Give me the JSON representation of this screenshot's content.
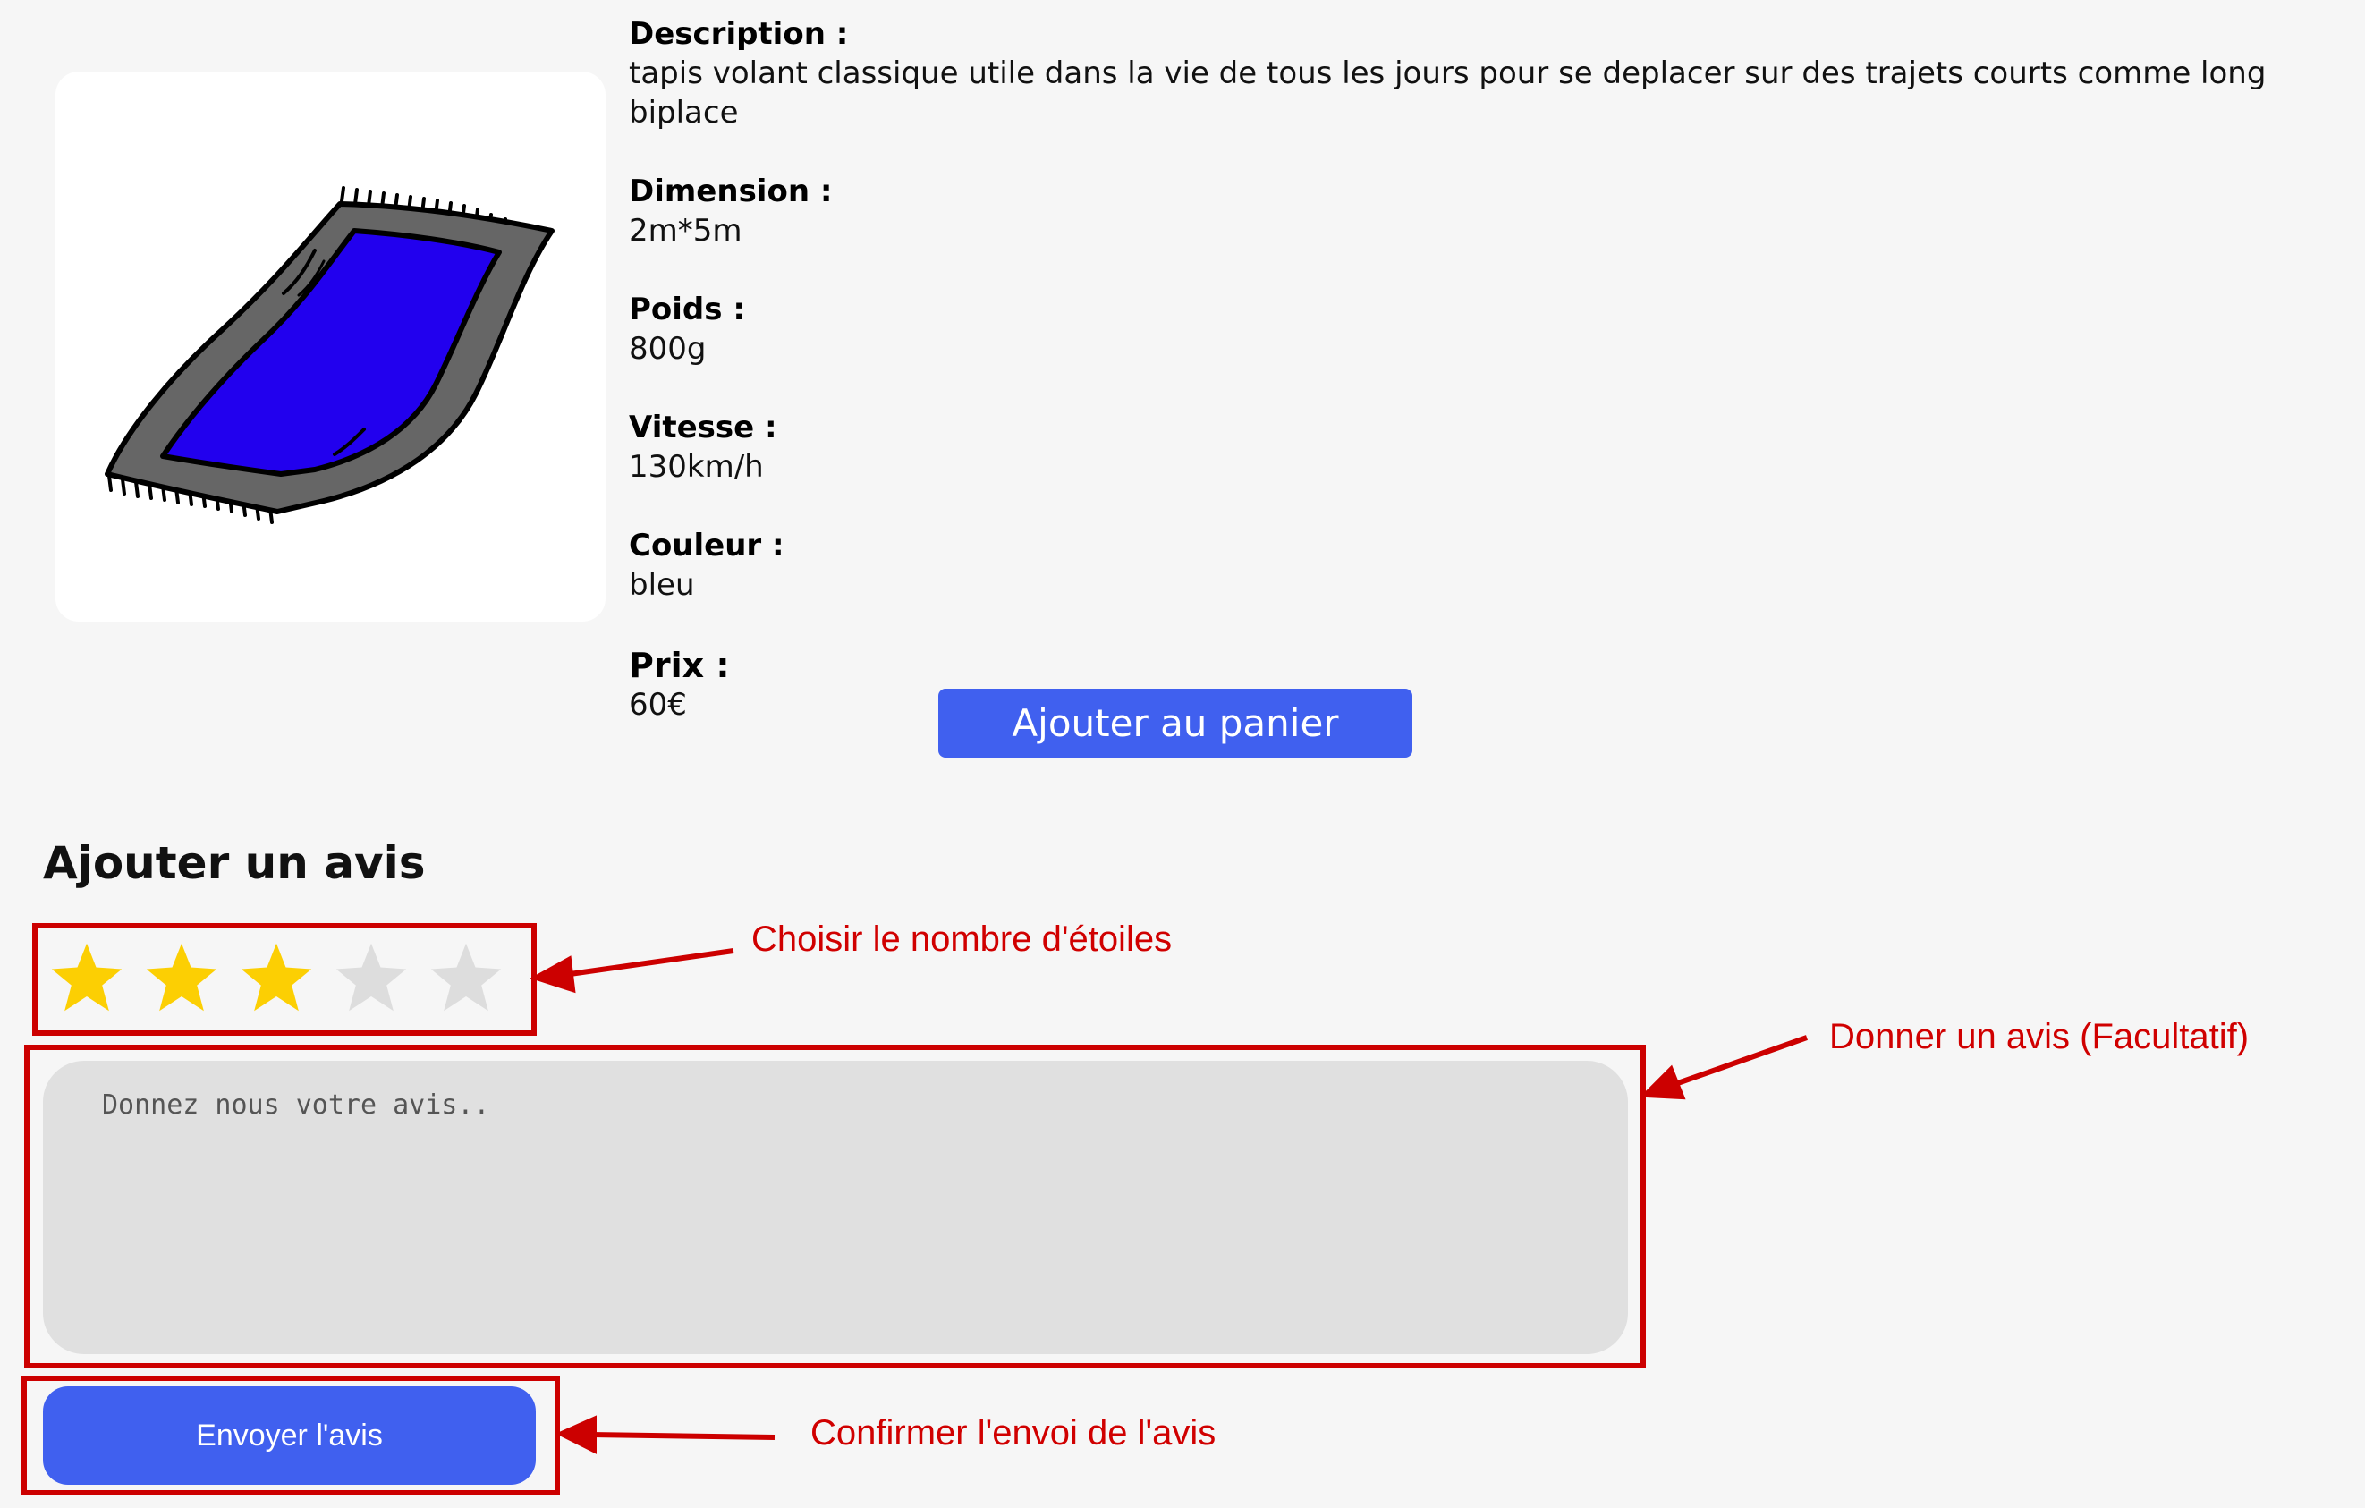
{
  "product": {
    "image_icon": "flying-carpet-illustration",
    "description_label": "Description :",
    "description_value": "tapis volant classique utile dans la vie de tous les jours pour se deplacer sur des trajets courts comme long biplace",
    "dimension_label": "Dimension :",
    "dimension_value": "2m*5m",
    "weight_label": "Poids :",
    "weight_value": "800g",
    "speed_label": "Vitesse :",
    "speed_value": "130km/h",
    "color_label": "Couleur :",
    "color_value": "bleu",
    "price_label": "Prix :",
    "price_value": "60€",
    "add_to_cart_label": "Ajouter au panier"
  },
  "review": {
    "title": "Ajouter un avis",
    "rating": 3,
    "rating_max": 5,
    "textarea_placeholder": "Donnez nous votre avis..",
    "submit_label": "Envoyer l'avis"
  },
  "annotations": {
    "stars": "Choisir le nombre d'étoiles",
    "textarea": "Donner un avis (Facultatif)",
    "submit": "Confirmer l'envoi de l'avis"
  },
  "colors": {
    "accent_blue": "#4060ef",
    "star_filled": "#fccf03",
    "star_empty": "#dddddd",
    "annotation_red": "#cc0000",
    "carpet_blue": "#2200ee",
    "carpet_border": "#666666"
  }
}
